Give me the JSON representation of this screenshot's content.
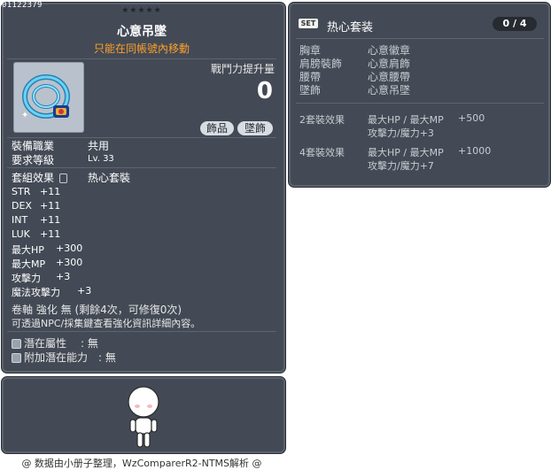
{
  "item": {
    "id": "01122379",
    "stars": "★★★★★",
    "name": "心意吊墜",
    "note": "只能在同帳號內移動",
    "attack_label": "戰鬥力提升量",
    "attack_value": "0",
    "tags": [
      "飾品",
      "墜飾"
    ],
    "job_label": "裝備職業",
    "job_value": "共用",
    "level_label": "要求等級",
    "level_value": "Lv. 33",
    "set_label": "套組效果",
    "set_name": "热心套裝",
    "stats": [
      {
        "name": "STR",
        "value": "+11"
      },
      {
        "name": "DEX",
        "value": "+11"
      },
      {
        "name": "INT",
        "value": "+11"
      },
      {
        "name": "LUK",
        "value": "+11"
      },
      {
        "name": "最大HP",
        "value": "+300"
      },
      {
        "name": "最大MP",
        "value": "+300"
      },
      {
        "name": "攻擊力",
        "value": "+3"
      },
      {
        "name": "魔法攻擊力",
        "value": "+3"
      }
    ],
    "scroll_line": "卷軸 強化 無 (剩餘4次，可修復0次)",
    "npc_line": "可透過NPC/採集鍵查看強化資訊詳細內容。",
    "potential_label": "潛在屬性",
    "potential_value": "無",
    "bonus_potential_label": "附加潛在能力",
    "bonus_potential_value": "無"
  },
  "set": {
    "badge": "SET",
    "title": "热心套装",
    "count": "0 / 4",
    "items": [
      {
        "slot": "胸章",
        "name": "心意徽章"
      },
      {
        "slot": "肩膀裝飾",
        "name": "心意肩飾"
      },
      {
        "slot": "腰帶",
        "name": "心意腰帶"
      },
      {
        "slot": "墜飾",
        "name": "心意吊墜"
      }
    ],
    "effects": [
      {
        "label": "2套裝效果",
        "line1_name": "最大HP / 最大MP",
        "line1_value": "+500",
        "line2": "攻擊力/魔力+3"
      },
      {
        "label": "4套裝效果",
        "line1_name": "最大HP / 最大MP",
        "line1_value": "+1000",
        "line2": "攻擊力/魔力+7"
      }
    ]
  },
  "credit": "@ 数据由小册子整理，WzComparerR2-NTMS解析 @",
  "colors": {
    "panel": "#434a55",
    "note": "#ff9f2b",
    "icon_bg": "#b9c2cc"
  }
}
